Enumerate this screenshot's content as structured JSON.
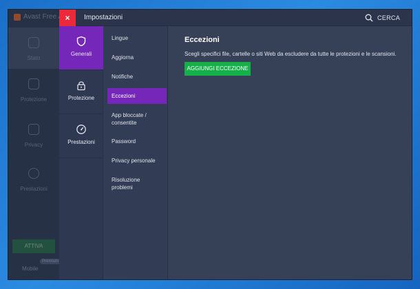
{
  "background_app": {
    "title": "Avast Free A",
    "items": [
      {
        "label": "Stato",
        "icon": "shield-check-icon"
      },
      {
        "label": "Protezione",
        "icon": "lock-icon"
      },
      {
        "label": "Privacy",
        "icon": "fingerprint-icon"
      },
      {
        "label": "Prestazioni",
        "icon": "gauge-icon"
      }
    ],
    "activate_label": "ATTIVA",
    "mobile_label": "Mobile",
    "badge": "Premium"
  },
  "settings": {
    "title": "Impostazioni",
    "close_label": "×",
    "search_label": "CERCA",
    "categories": [
      {
        "label": "Generali",
        "icon": "shield-icon",
        "active": true
      },
      {
        "label": "Protezione",
        "icon": "lock-icon",
        "active": false
      },
      {
        "label": "Prestazioni",
        "icon": "gauge-icon",
        "active": false
      }
    ],
    "subitems": [
      {
        "label": "Lingue"
      },
      {
        "label": "Aggiorna"
      },
      {
        "label": "Notifiche"
      },
      {
        "label": "Eccezioni",
        "active": true
      },
      {
        "label": "App bloccate / consentite"
      },
      {
        "label": "Password"
      },
      {
        "label": "Privacy personale"
      },
      {
        "label": "Risoluzione problemi"
      }
    ],
    "content": {
      "heading": "Eccezioni",
      "description": "Scegli specifici file, cartelle o siti Web da escludere da tutte le protezioni e le scansioni.",
      "add_button": "AGGIUNGI ECCEZIONE"
    }
  },
  "colors": {
    "accent_purple": "#7427b8",
    "close_red": "#ea2a3b",
    "button_green": "#16b04a"
  }
}
